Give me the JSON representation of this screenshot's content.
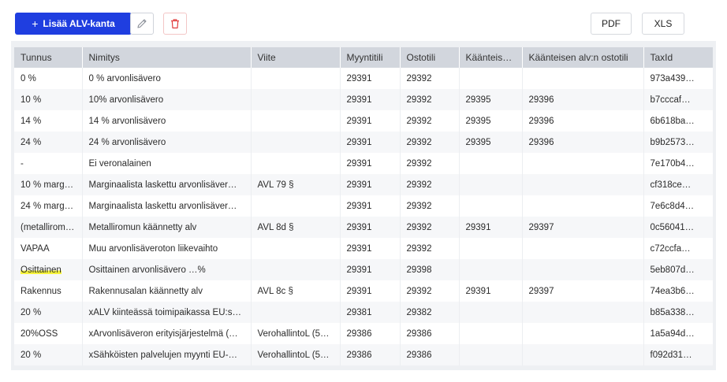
{
  "toolbar": {
    "add_label": "Lisää ALV-kanta",
    "add_plus": "+",
    "pdf_label": "PDF",
    "xls_label": "XLS"
  },
  "colors": {
    "primary": "#1f3ee0",
    "delete": "#e03c3c",
    "highlight": "#f6f33a"
  },
  "table": {
    "columns": [
      "Tunnus",
      "Nimitys",
      "Viite",
      "Myyntitili",
      "Ostotili",
      "Kääntеis…",
      "Käänteisen alv:n ostotili",
      "TaxId"
    ],
    "rows": [
      [
        "0 %",
        "0 % arvonlisävero",
        "",
        "29391",
        "29392",
        "",
        "",
        "973a439…"
      ],
      [
        "10 %",
        "10% arvonlisävero",
        "",
        "29391",
        "29392",
        "29395",
        "29396",
        "b7cccaf…"
      ],
      [
        "14 %",
        "14 % arvonlisävero",
        "",
        "29391",
        "29392",
        "29395",
        "29396",
        "6b618ba…"
      ],
      [
        "24 %",
        "24 % arvonlisävero",
        "",
        "29391",
        "29392",
        "29395",
        "29396",
        "b9b2573…"
      ],
      [
        "-",
        "Ei veronalainen",
        "",
        "29391",
        "29392",
        "",
        "",
        "7e170b4…"
      ],
      [
        "10 % margi…",
        "Marginaalista laskettu arvonlisäver…",
        "AVL 79 §",
        "29391",
        "29392",
        "",
        "",
        "cf318ce…"
      ],
      [
        "24 % margi…",
        "Marginaalista laskettu arvonlisäver…",
        "",
        "29391",
        "29392",
        "",
        "",
        "7e6c8d4…"
      ],
      [
        "(metalliromu…",
        "Metalliromun käännetty alv",
        "AVL 8d §",
        "29391",
        "29392",
        "29391",
        "29397",
        "0c56041…"
      ],
      [
        "VAPAA",
        "Muu arvonlisäveroton liikevaihto",
        "",
        "29391",
        "29392",
        "",
        "",
        "c72ccfa…"
      ],
      [
        "Osittainen",
        "Osittainen arvonlisävero …%",
        "",
        "29391",
        "29398",
        "",
        "",
        "5eb807d…"
      ],
      [
        "Rakennus",
        "Rakennusalan käännetty alv",
        "AVL 8c §",
        "29391",
        "29392",
        "29391",
        "29397",
        "74ea3b6…"
      ],
      [
        "20 %",
        "xALV kiinteässä toimipaikassa EU:s…",
        "",
        "29381",
        "29382",
        "",
        "",
        "b85a338…"
      ],
      [
        "20%OSS",
        "xArvonlisäveron erityisjärjestelmä (…",
        "VerohallintoL (5…",
        "29386",
        "29386",
        "",
        "",
        "1a5a94d…"
      ],
      [
        "20 %",
        "xSähköisten palvelujen myynti EU-…",
        "VerohallintoL (5…",
        "29386",
        "29386",
        "",
        "",
        "f092d31…"
      ]
    ],
    "highlighted_row": 9
  }
}
